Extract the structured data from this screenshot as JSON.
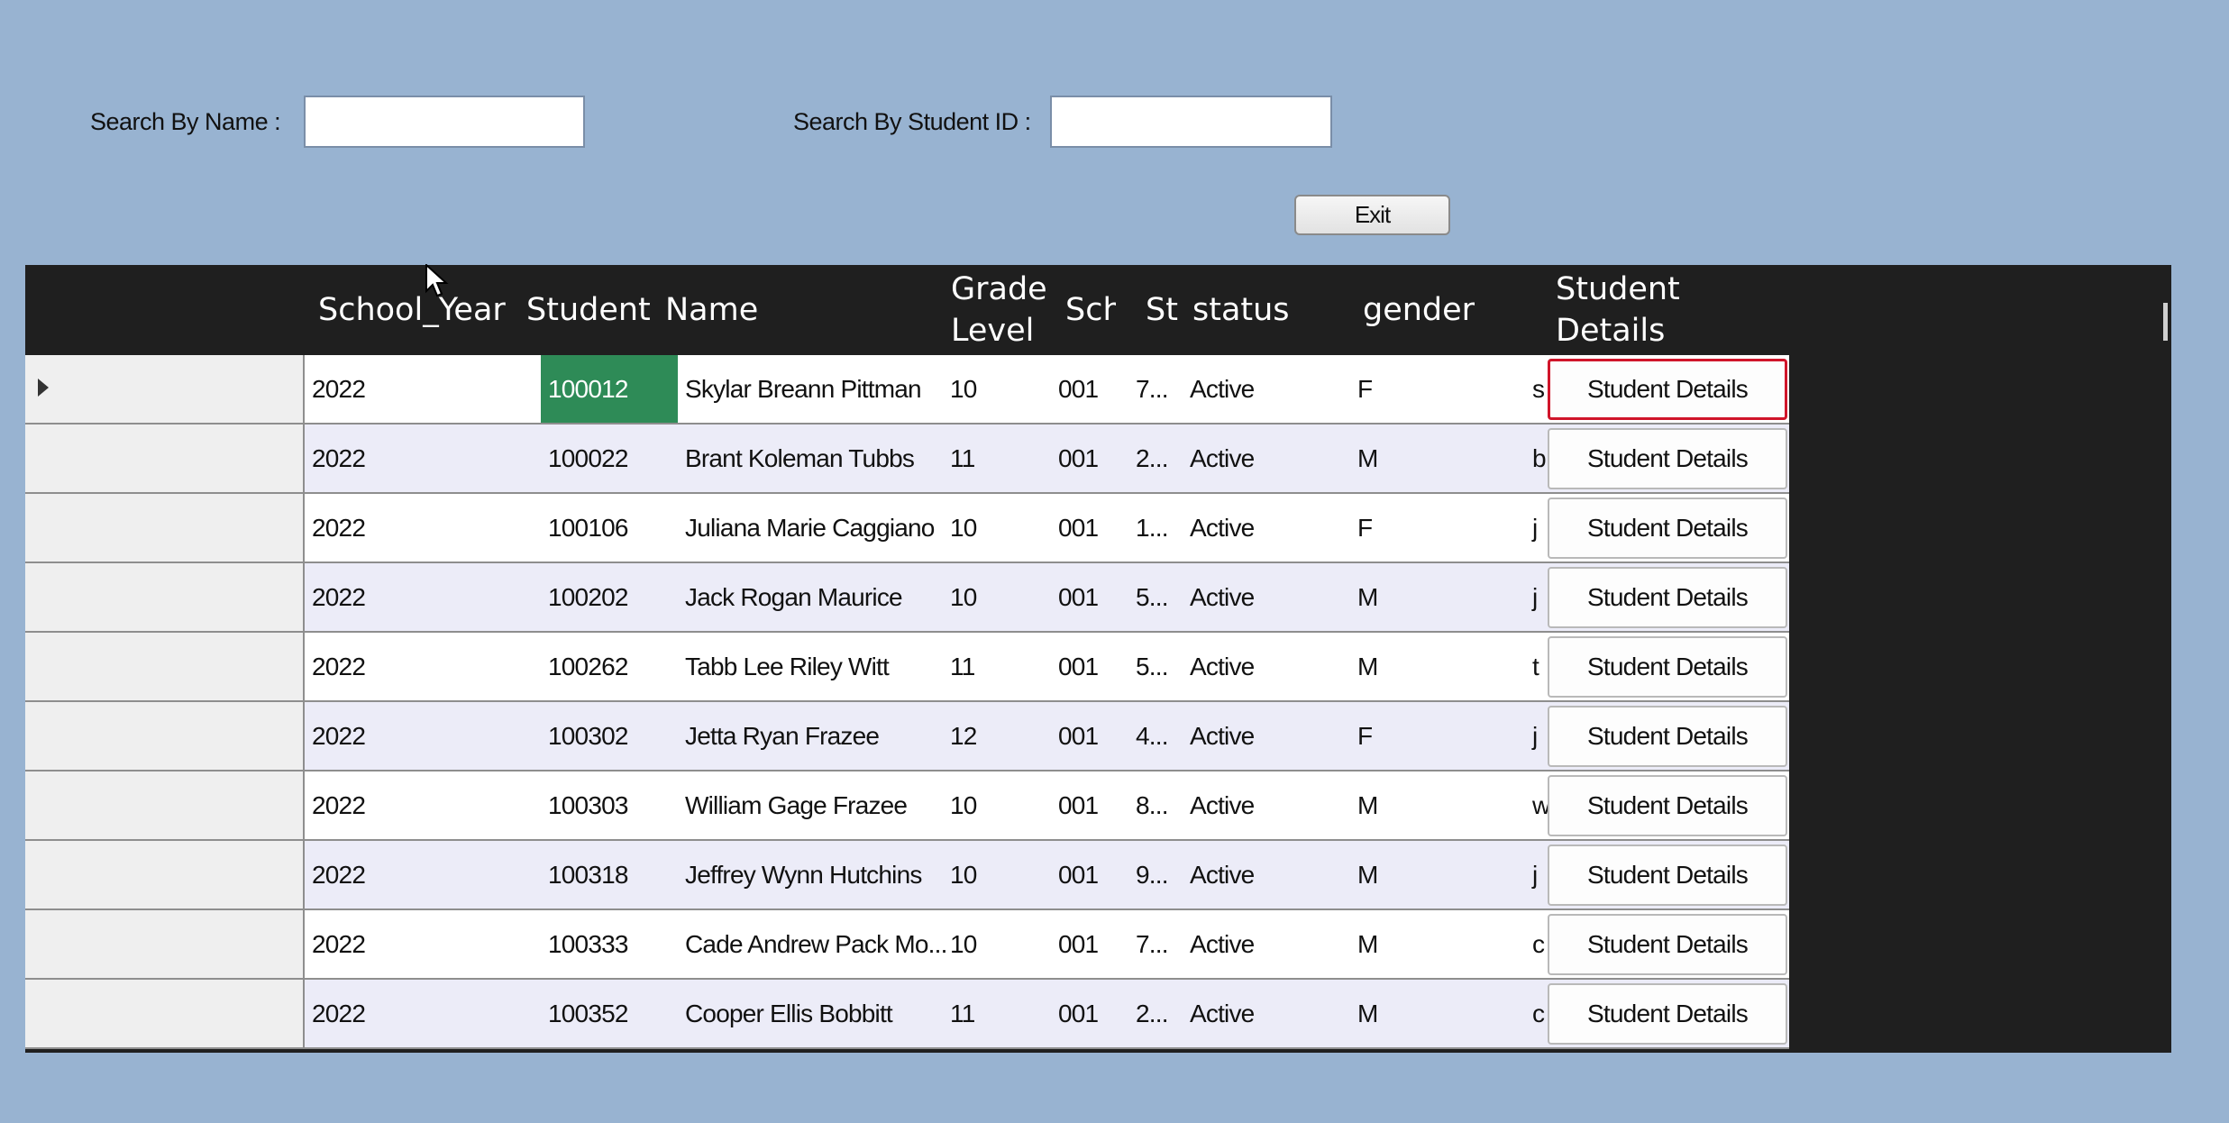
{
  "search": {
    "name_label": "Search By Name :",
    "name_value": "",
    "id_label": "Search By Student ID :",
    "id_value": ""
  },
  "exit_label": "Exit",
  "grid": {
    "columns": [
      "School_Year",
      "Student",
      "Name",
      "Grade Level",
      "Sch",
      "St",
      "status",
      "gender",
      "Student Details"
    ],
    "rows": [
      {
        "year": "2022",
        "id": "100012",
        "name": "Skylar Breann Pittman",
        "grade": "10",
        "sch": "001",
        "st": "7...",
        "status": "Active",
        "gender": "F",
        "email": "s",
        "button": "Student Details"
      },
      {
        "year": "2022",
        "id": "100022",
        "name": "Brant Koleman Tubbs",
        "grade": "11",
        "sch": "001",
        "st": "2...",
        "status": "Active",
        "gender": "M",
        "email": "b",
        "button": "Student Details"
      },
      {
        "year": "2022",
        "id": "100106",
        "name": "Juliana Marie Caggiano",
        "grade": "10",
        "sch": "001",
        "st": "1...",
        "status": "Active",
        "gender": "F",
        "email": "j",
        "button": "Student Details"
      },
      {
        "year": "2022",
        "id": "100202",
        "name": "Jack Rogan Maurice",
        "grade": "10",
        "sch": "001",
        "st": "5...",
        "status": "Active",
        "gender": "M",
        "email": "j",
        "button": "Student Details"
      },
      {
        "year": "2022",
        "id": "100262",
        "name": "Tabb Lee Riley Witt",
        "grade": "11",
        "sch": "001",
        "st": "5...",
        "status": "Active",
        "gender": "M",
        "email": "t",
        "button": "Student Details"
      },
      {
        "year": "2022",
        "id": "100302",
        "name": "Jetta Ryan Frazee",
        "grade": "12",
        "sch": "001",
        "st": "4...",
        "status": "Active",
        "gender": "F",
        "email": "j",
        "button": "Student Details"
      },
      {
        "year": "2022",
        "id": "100303",
        "name": "William Gage Frazee",
        "grade": "10",
        "sch": "001",
        "st": "8...",
        "status": "Active",
        "gender": "M",
        "email": "w",
        "button": "Student Details"
      },
      {
        "year": "2022",
        "id": "100318",
        "name": "Jeffrey Wynn Hutchins",
        "grade": "10",
        "sch": "001",
        "st": "9...",
        "status": "Active",
        "gender": "M",
        "email": "j",
        "button": "Student Details"
      },
      {
        "year": "2022",
        "id": "100333",
        "name": "Cade Andrew Pack Mo...",
        "grade": "10",
        "sch": "001",
        "st": "7...",
        "status": "Active",
        "gender": "M",
        "email": "c",
        "button": "Student Details"
      },
      {
        "year": "2022",
        "id": "100352",
        "name": "Cooper Ellis Bobbitt",
        "grade": "11",
        "sch": "001",
        "st": "2...",
        "status": "Active",
        "gender": "M",
        "email": "c",
        "button": "Student Details"
      }
    ]
  },
  "colors": {
    "background": "#98b3d1",
    "grid_header": "#1f1f1f",
    "row_odd": "#ffffff",
    "row_even": "#ececf8",
    "selected_cell": "#2e8b57",
    "focus_border": "#d0152a"
  },
  "icons": {
    "row_indicator": "triangle-right",
    "cursor": "arrow-cursor"
  }
}
